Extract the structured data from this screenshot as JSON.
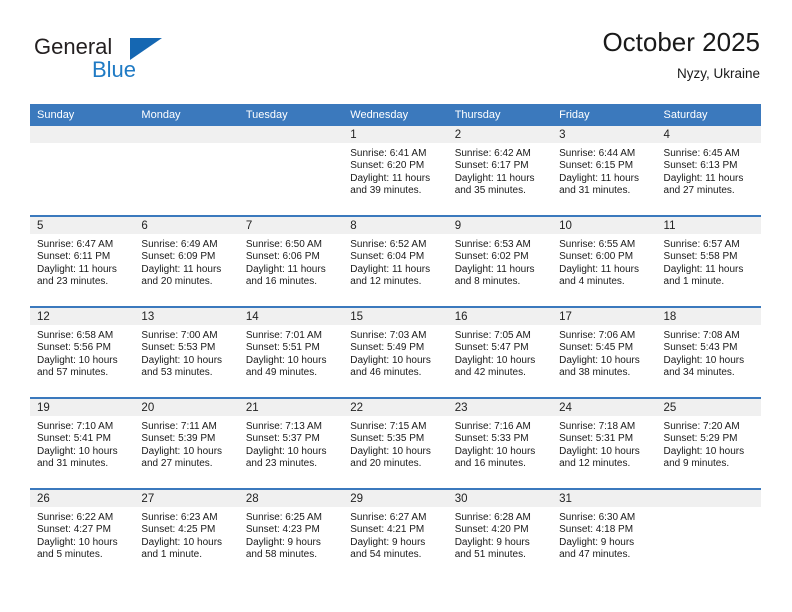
{
  "brand": {
    "name_part1": "General",
    "name_part2": "Blue",
    "triangle_color": "#1567b2",
    "blue_color": "#1f7ac4"
  },
  "header": {
    "title": "October 2025",
    "subtitle": "Nyzy, Ukraine"
  },
  "theme": {
    "header_row_bg": "#3b79bd",
    "daynum_band_bg": "#f0f0f0",
    "grid_line": "#3b79bd"
  },
  "weekdays": [
    "Sunday",
    "Monday",
    "Tuesday",
    "Wednesday",
    "Thursday",
    "Friday",
    "Saturday"
  ],
  "weeks": [
    [
      {
        "day": "",
        "empty": true,
        "sunrise": "",
        "sunset": "",
        "daylight_1": "",
        "daylight_2": ""
      },
      {
        "day": "",
        "empty": true,
        "sunrise": "",
        "sunset": "",
        "daylight_1": "",
        "daylight_2": ""
      },
      {
        "day": "",
        "empty": true,
        "sunrise": "",
        "sunset": "",
        "daylight_1": "",
        "daylight_2": ""
      },
      {
        "day": "1",
        "empty": false,
        "sunrise": "Sunrise: 6:41 AM",
        "sunset": "Sunset: 6:20 PM",
        "daylight_1": "Daylight: 11 hours",
        "daylight_2": "and 39 minutes."
      },
      {
        "day": "2",
        "empty": false,
        "sunrise": "Sunrise: 6:42 AM",
        "sunset": "Sunset: 6:17 PM",
        "daylight_1": "Daylight: 11 hours",
        "daylight_2": "and 35 minutes."
      },
      {
        "day": "3",
        "empty": false,
        "sunrise": "Sunrise: 6:44 AM",
        "sunset": "Sunset: 6:15 PM",
        "daylight_1": "Daylight: 11 hours",
        "daylight_2": "and 31 minutes."
      },
      {
        "day": "4",
        "empty": false,
        "sunrise": "Sunrise: 6:45 AM",
        "sunset": "Sunset: 6:13 PM",
        "daylight_1": "Daylight: 11 hours",
        "daylight_2": "and 27 minutes."
      }
    ],
    [
      {
        "day": "5",
        "empty": false,
        "sunrise": "Sunrise: 6:47 AM",
        "sunset": "Sunset: 6:11 PM",
        "daylight_1": "Daylight: 11 hours",
        "daylight_2": "and 23 minutes."
      },
      {
        "day": "6",
        "empty": false,
        "sunrise": "Sunrise: 6:49 AM",
        "sunset": "Sunset: 6:09 PM",
        "daylight_1": "Daylight: 11 hours",
        "daylight_2": "and 20 minutes."
      },
      {
        "day": "7",
        "empty": false,
        "sunrise": "Sunrise: 6:50 AM",
        "sunset": "Sunset: 6:06 PM",
        "daylight_1": "Daylight: 11 hours",
        "daylight_2": "and 16 minutes."
      },
      {
        "day": "8",
        "empty": false,
        "sunrise": "Sunrise: 6:52 AM",
        "sunset": "Sunset: 6:04 PM",
        "daylight_1": "Daylight: 11 hours",
        "daylight_2": "and 12 minutes."
      },
      {
        "day": "9",
        "empty": false,
        "sunrise": "Sunrise: 6:53 AM",
        "sunset": "Sunset: 6:02 PM",
        "daylight_1": "Daylight: 11 hours",
        "daylight_2": "and 8 minutes."
      },
      {
        "day": "10",
        "empty": false,
        "sunrise": "Sunrise: 6:55 AM",
        "sunset": "Sunset: 6:00 PM",
        "daylight_1": "Daylight: 11 hours",
        "daylight_2": "and 4 minutes."
      },
      {
        "day": "11",
        "empty": false,
        "sunrise": "Sunrise: 6:57 AM",
        "sunset": "Sunset: 5:58 PM",
        "daylight_1": "Daylight: 11 hours",
        "daylight_2": "and 1 minute."
      }
    ],
    [
      {
        "day": "12",
        "empty": false,
        "sunrise": "Sunrise: 6:58 AM",
        "sunset": "Sunset: 5:56 PM",
        "daylight_1": "Daylight: 10 hours",
        "daylight_2": "and 57 minutes."
      },
      {
        "day": "13",
        "empty": false,
        "sunrise": "Sunrise: 7:00 AM",
        "sunset": "Sunset: 5:53 PM",
        "daylight_1": "Daylight: 10 hours",
        "daylight_2": "and 53 minutes."
      },
      {
        "day": "14",
        "empty": false,
        "sunrise": "Sunrise: 7:01 AM",
        "sunset": "Sunset: 5:51 PM",
        "daylight_1": "Daylight: 10 hours",
        "daylight_2": "and 49 minutes."
      },
      {
        "day": "15",
        "empty": false,
        "sunrise": "Sunrise: 7:03 AM",
        "sunset": "Sunset: 5:49 PM",
        "daylight_1": "Daylight: 10 hours",
        "daylight_2": "and 46 minutes."
      },
      {
        "day": "16",
        "empty": false,
        "sunrise": "Sunrise: 7:05 AM",
        "sunset": "Sunset: 5:47 PM",
        "daylight_1": "Daylight: 10 hours",
        "daylight_2": "and 42 minutes."
      },
      {
        "day": "17",
        "empty": false,
        "sunrise": "Sunrise: 7:06 AM",
        "sunset": "Sunset: 5:45 PM",
        "daylight_1": "Daylight: 10 hours",
        "daylight_2": "and 38 minutes."
      },
      {
        "day": "18",
        "empty": false,
        "sunrise": "Sunrise: 7:08 AM",
        "sunset": "Sunset: 5:43 PM",
        "daylight_1": "Daylight: 10 hours",
        "daylight_2": "and 34 minutes."
      }
    ],
    [
      {
        "day": "19",
        "empty": false,
        "sunrise": "Sunrise: 7:10 AM",
        "sunset": "Sunset: 5:41 PM",
        "daylight_1": "Daylight: 10 hours",
        "daylight_2": "and 31 minutes."
      },
      {
        "day": "20",
        "empty": false,
        "sunrise": "Sunrise: 7:11 AM",
        "sunset": "Sunset: 5:39 PM",
        "daylight_1": "Daylight: 10 hours",
        "daylight_2": "and 27 minutes."
      },
      {
        "day": "21",
        "empty": false,
        "sunrise": "Sunrise: 7:13 AM",
        "sunset": "Sunset: 5:37 PM",
        "daylight_1": "Daylight: 10 hours",
        "daylight_2": "and 23 minutes."
      },
      {
        "day": "22",
        "empty": false,
        "sunrise": "Sunrise: 7:15 AM",
        "sunset": "Sunset: 5:35 PM",
        "daylight_1": "Daylight: 10 hours",
        "daylight_2": "and 20 minutes."
      },
      {
        "day": "23",
        "empty": false,
        "sunrise": "Sunrise: 7:16 AM",
        "sunset": "Sunset: 5:33 PM",
        "daylight_1": "Daylight: 10 hours",
        "daylight_2": "and 16 minutes."
      },
      {
        "day": "24",
        "empty": false,
        "sunrise": "Sunrise: 7:18 AM",
        "sunset": "Sunset: 5:31 PM",
        "daylight_1": "Daylight: 10 hours",
        "daylight_2": "and 12 minutes."
      },
      {
        "day": "25",
        "empty": false,
        "sunrise": "Sunrise: 7:20 AM",
        "sunset": "Sunset: 5:29 PM",
        "daylight_1": "Daylight: 10 hours",
        "daylight_2": "and 9 minutes."
      }
    ],
    [
      {
        "day": "26",
        "empty": false,
        "sunrise": "Sunrise: 6:22 AM",
        "sunset": "Sunset: 4:27 PM",
        "daylight_1": "Daylight: 10 hours",
        "daylight_2": "and 5 minutes."
      },
      {
        "day": "27",
        "empty": false,
        "sunrise": "Sunrise: 6:23 AM",
        "sunset": "Sunset: 4:25 PM",
        "daylight_1": "Daylight: 10 hours",
        "daylight_2": "and 1 minute."
      },
      {
        "day": "28",
        "empty": false,
        "sunrise": "Sunrise: 6:25 AM",
        "sunset": "Sunset: 4:23 PM",
        "daylight_1": "Daylight: 9 hours",
        "daylight_2": "and 58 minutes."
      },
      {
        "day": "29",
        "empty": false,
        "sunrise": "Sunrise: 6:27 AM",
        "sunset": "Sunset: 4:21 PM",
        "daylight_1": "Daylight: 9 hours",
        "daylight_2": "and 54 minutes."
      },
      {
        "day": "30",
        "empty": false,
        "sunrise": "Sunrise: 6:28 AM",
        "sunset": "Sunset: 4:20 PM",
        "daylight_1": "Daylight: 9 hours",
        "daylight_2": "and 51 minutes."
      },
      {
        "day": "31",
        "empty": false,
        "sunrise": "Sunrise: 6:30 AM",
        "sunset": "Sunset: 4:18 PM",
        "daylight_1": "Daylight: 9 hours",
        "daylight_2": "and 47 minutes."
      },
      {
        "day": "",
        "empty": true,
        "sunrise": "",
        "sunset": "",
        "daylight_1": "",
        "daylight_2": ""
      }
    ]
  ]
}
